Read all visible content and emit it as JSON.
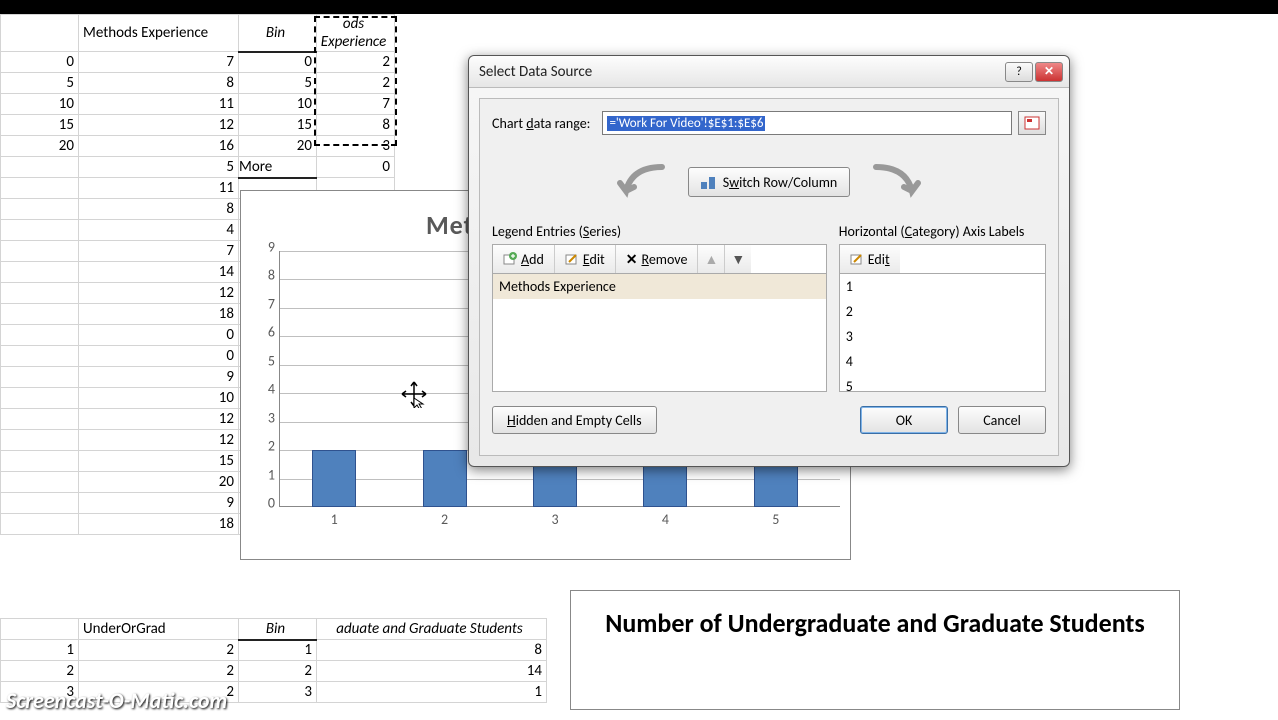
{
  "sheet": {
    "block1": {
      "headers": [
        "",
        "Methods Experience",
        "Bin",
        "ods Experience"
      ],
      "rows": [
        [
          "0",
          "7",
          "0",
          "2"
        ],
        [
          "5",
          "8",
          "5",
          "2"
        ],
        [
          "10",
          "11",
          "10",
          "7"
        ],
        [
          "15",
          "12",
          "15",
          "8"
        ],
        [
          "20",
          "16",
          "20",
          "3"
        ],
        [
          "",
          "5",
          "More",
          "0"
        ],
        [
          "",
          "11",
          "",
          ""
        ],
        [
          "",
          "8",
          "",
          ""
        ],
        [
          "",
          "4",
          "",
          ""
        ],
        [
          "",
          "7",
          "",
          ""
        ],
        [
          "",
          "14",
          "",
          ""
        ],
        [
          "",
          "12",
          "",
          ""
        ],
        [
          "",
          "18",
          "",
          ""
        ],
        [
          "",
          "0",
          "",
          ""
        ],
        [
          "",
          "0",
          "",
          ""
        ],
        [
          "",
          "9",
          "",
          ""
        ],
        [
          "",
          "10",
          "",
          ""
        ],
        [
          "",
          "12",
          "",
          ""
        ],
        [
          "",
          "12",
          "",
          ""
        ],
        [
          "",
          "15",
          "",
          ""
        ],
        [
          "",
          "20",
          "",
          ""
        ],
        [
          "",
          "9",
          "",
          ""
        ],
        [
          "",
          "18",
          "",
          ""
        ]
      ]
    },
    "block2": {
      "headers": [
        "",
        "UnderOrGrad",
        "Bin",
        "aduate and Graduate Students"
      ],
      "rows": [
        [
          "1",
          "2",
          "1",
          "8"
        ],
        [
          "2",
          "2",
          "2",
          "14"
        ],
        [
          "3",
          "2",
          "3",
          "1"
        ]
      ]
    }
  },
  "chart_data": [
    {
      "type": "bar",
      "title": "Methods Experience",
      "categories": [
        "1",
        "2",
        "3",
        "4",
        "5"
      ],
      "values": [
        2,
        2,
        7,
        8,
        3
      ],
      "ylabel": "",
      "xlabel": "",
      "ylim": [
        0,
        9
      ],
      "yticks": [
        0,
        1,
        2,
        3,
        4,
        5,
        6,
        7,
        8,
        9
      ]
    },
    {
      "type": "bar",
      "title": "Number of Undergraduate and Graduate Students",
      "categories": [],
      "values": [],
      "ylim": [
        0,
        16
      ]
    }
  ],
  "dialog": {
    "title": "Select Data Source",
    "range_label_pre": "Chart ",
    "range_label_u": "d",
    "range_label_post": "ata range:",
    "range_value": "='Work For Video'!$E$1:$E$6",
    "switch_pre": "S",
    "switch_u": "w",
    "switch_post": "itch Row/Column",
    "legend_label_pre": "Legend Entries (",
    "legend_label_u": "S",
    "legend_label_post": "eries)",
    "axis_label_pre": "Horizontal (",
    "axis_label_u": "C",
    "axis_label_post": "ategory) Axis Labels",
    "add_u": "A",
    "add_post": "dd",
    "edit_u": "E",
    "edit_post": "dit",
    "remove_u": "R",
    "remove_post": "emove",
    "edit2_pre": "Edi",
    "edit2_u": "t",
    "series": [
      "Methods Experience"
    ],
    "axis_items": [
      "1",
      "2",
      "3",
      "4",
      "5"
    ],
    "hidden_u": "H",
    "hidden_post": "idden and Empty Cells",
    "ok": "OK",
    "cancel": "Cancel"
  },
  "watermark": "Screencast-O-Matic.com"
}
